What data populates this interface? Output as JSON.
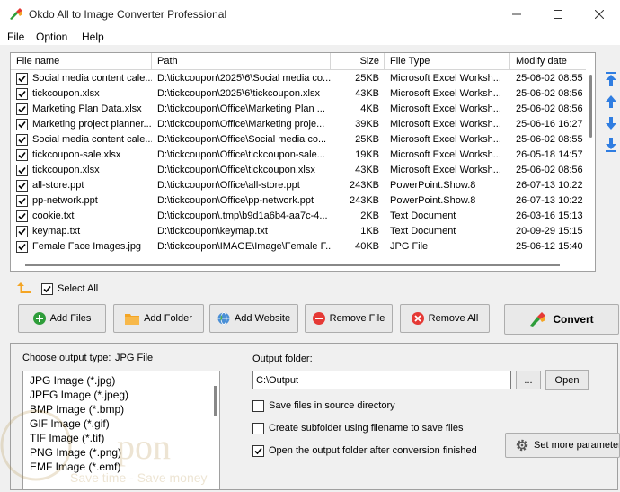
{
  "window": {
    "title": "Okdo All to Image Converter Professional"
  },
  "menu": [
    "File",
    "Option",
    "Help"
  ],
  "table": {
    "columns": [
      {
        "label": "File name"
      },
      {
        "label": "Path"
      },
      {
        "label": "Size"
      },
      {
        "label": "File Type"
      },
      {
        "label": "Modify date"
      }
    ],
    "rows": [
      {
        "name": "Social media content cale...",
        "path": "D:\\tickcoupon\\2025\\6\\Social media co...",
        "size": "25KB",
        "type": "Microsoft Excel Worksh...",
        "date": "25-06-02 08:55"
      },
      {
        "name": "tickcoupon.xlsx",
        "path": "D:\\tickcoupon\\2025\\6\\tickcoupon.xlsx",
        "size": "43KB",
        "type": "Microsoft Excel Worksh...",
        "date": "25-06-02 08:56"
      },
      {
        "name": "Marketing Plan Data.xlsx",
        "path": "D:\\tickcoupon\\Office\\Marketing Plan ...",
        "size": "4KB",
        "type": "Microsoft Excel Worksh...",
        "date": "25-06-02 08:56"
      },
      {
        "name": "Marketing project planner....",
        "path": "D:\\tickcoupon\\Office\\Marketing proje...",
        "size": "39KB",
        "type": "Microsoft Excel Worksh...",
        "date": "25-06-16 16:27"
      },
      {
        "name": "Social media content cale...",
        "path": "D:\\tickcoupon\\Office\\Social media co...",
        "size": "25KB",
        "type": "Microsoft Excel Worksh...",
        "date": "25-06-02 08:55"
      },
      {
        "name": "tickcoupon-sale.xlsx",
        "path": "D:\\tickcoupon\\Office\\tickcoupon-sale...",
        "size": "19KB",
        "type": "Microsoft Excel Worksh...",
        "date": "26-05-18 14:57"
      },
      {
        "name": "tickcoupon.xlsx",
        "path": "D:\\tickcoupon\\Office\\tickcoupon.xlsx",
        "size": "43KB",
        "type": "Microsoft Excel Worksh...",
        "date": "25-06-02 08:56"
      },
      {
        "name": "all-store.ppt",
        "path": "D:\\tickcoupon\\Office\\all-store.ppt",
        "size": "243KB",
        "type": "PowerPoint.Show.8",
        "date": "26-07-13 10:22"
      },
      {
        "name": "pp-network.ppt",
        "path": "D:\\tickcoupon\\Office\\pp-network.ppt",
        "size": "243KB",
        "type": "PowerPoint.Show.8",
        "date": "26-07-13 10:22"
      },
      {
        "name": "cookie.txt",
        "path": "D:\\tickcoupon\\.tmp\\b9d1a6b4-aa7c-4...",
        "size": "2KB",
        "type": "Text Document",
        "date": "26-03-16 15:13"
      },
      {
        "name": "keymap.txt",
        "path": "D:\\tickcoupon\\keymap.txt",
        "size": "1KB",
        "type": "Text Document",
        "date": "20-09-29 15:15"
      },
      {
        "name": "Female Face Images.jpg",
        "path": "D:\\tickcoupon\\IMAGE\\Image\\Female F...",
        "size": "40KB",
        "type": "JPG File",
        "date": "25-06-12 15:40"
      }
    ]
  },
  "select_all": {
    "label": "Select All",
    "checked": true
  },
  "buttons": {
    "add_files": "Add Files",
    "add_folder": "Add Folder",
    "add_website": "Add Website",
    "remove_file": "Remove File",
    "remove_all": "Remove All",
    "convert": "Convert",
    "browse": "...",
    "open": "Open",
    "set_params": "Set more parameters"
  },
  "output": {
    "choose_label": "Choose output type:",
    "selected_type": "JPG File",
    "types": [
      "JPG Image (*.jpg)",
      "JPEG Image (*.jpeg)",
      "BMP Image (*.bmp)",
      "GIF Image (*.gif)",
      "TIF Image (*.tif)",
      "PNG Image (*.png)",
      "EMF Image (*.emf)"
    ],
    "folder_label": "Output folder:",
    "folder_value": "C:\\Output",
    "options": [
      {
        "label": "Save files in source directory",
        "checked": false
      },
      {
        "label": "Create subfolder using filename to save files",
        "checked": false
      },
      {
        "label": "Open the output folder after conversion finished",
        "checked": true
      }
    ]
  },
  "watermark": {
    "text": "pon",
    "tagline": "Save time - Save money"
  },
  "colors": {
    "accent": "#2f7de1",
    "check": "#000000",
    "remove_red": "#e53935",
    "add_green": "#2e9d3a",
    "folder_orange": "#f4a524"
  }
}
